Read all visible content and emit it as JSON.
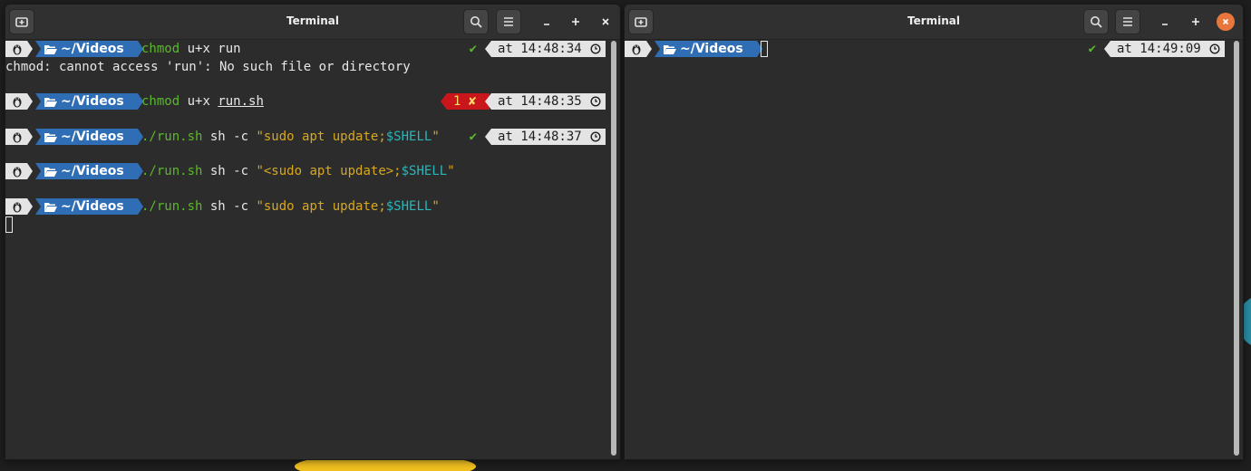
{
  "left_window": {
    "title": "Terminal",
    "lines": [
      {
        "dir": "~/Videos",
        "cmd_name": "chmod",
        "cmd_args": " u+x run",
        "status": "✔",
        "time": "at 14:48:34"
      },
      {
        "output": "chmod: cannot access 'run': No such file or directory"
      },
      {
        "dir": "~/Videos",
        "cmd_name": "chmod",
        "cmd_args_pre": " u+x ",
        "cmd_args_ul": "run.sh",
        "error_code": "1 ✘",
        "time": "at 14:48:35"
      },
      {
        "dir": "~/Videos",
        "cmd_name": "./run.sh",
        "cmd_args_pre": " sh -c ",
        "string_open": "\"sudo apt update;",
        "var": "$SHELL",
        "string_close": "\"",
        "status": "✔",
        "time": "at 14:48:37"
      },
      {
        "dir": "~/Videos",
        "cmd_name": "./run.sh",
        "cmd_args_pre": " sh -c ",
        "string_open": "\"<sudo apt update>;",
        "var": "$SHELL",
        "string_close": "\""
      },
      {
        "dir": "~/Videos",
        "cmd_name": "./run.sh",
        "cmd_args_pre": " sh -c ",
        "string_open": "\"sudo apt update;",
        "var": "$SHELL",
        "string_close": "\""
      }
    ]
  },
  "right_window": {
    "title": "Terminal",
    "prompt": {
      "dir": "~/Videos",
      "status": "✔",
      "time": "at 14:49:09"
    }
  },
  "colors": {
    "prompt_dir_bg": "#2f6db5",
    "prompt_os_bg": "#e4e4e4",
    "command_green": "#5cb82d",
    "string_yellow": "#d8a81e",
    "variable_cyan": "#2ab6b9",
    "error_red": "#c8161b",
    "close_active": "#e8763d"
  }
}
